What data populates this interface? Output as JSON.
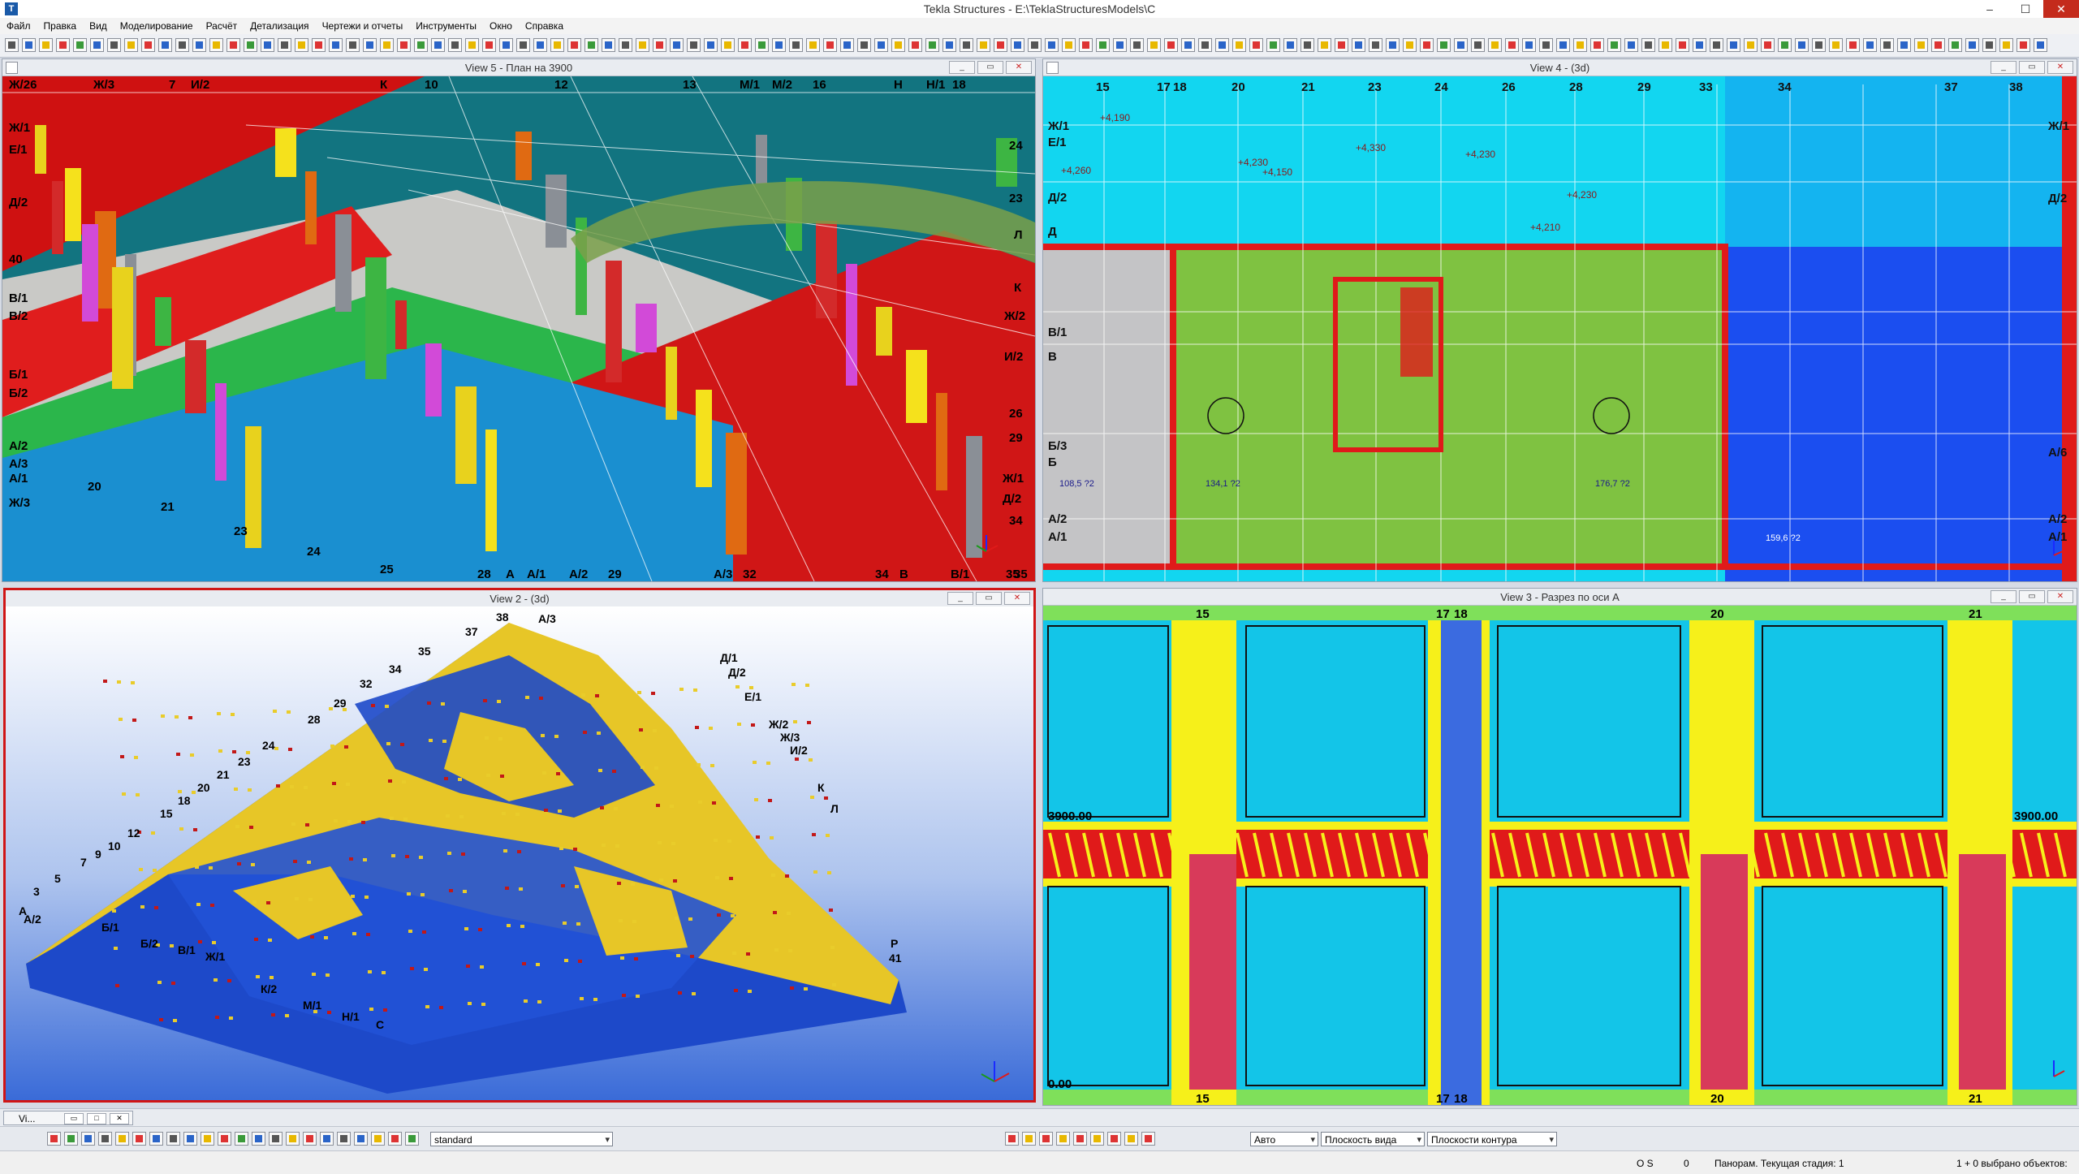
{
  "app": {
    "title": "Tekla Structures - E:\\TeklaStructuresModels\\C"
  },
  "menu": [
    "Файл",
    "Правка",
    "Вид",
    "Моделирование",
    "Расчёт",
    "Детализация",
    "Чертежи и отчеты",
    "Инструменты",
    "Окно",
    "Справка"
  ],
  "views": {
    "view5": {
      "title": "View 5 - План на 3900",
      "grid_labels_top": [
        "Ж/26",
        "Ж/3",
        "7",
        "И/2",
        "К",
        "10",
        "12",
        "13",
        "М/1",
        "М/2",
        "16",
        "Н",
        "Н/1",
        "18"
      ],
      "grid_labels_left": [
        "Ж/1",
        "Е/1",
        "Д/2",
        "40",
        "В/1",
        "В/2",
        "Б/1",
        "Б/2",
        "А/2",
        "А/3",
        "А/1",
        "Ж/3"
      ],
      "grid_labels_right": [
        "24",
        "23",
        "Л",
        "К",
        "Ж/2",
        "И/2",
        "29",
        "26",
        "Ж/1",
        "Д/2",
        "34",
        "35"
      ],
      "grid_labels_bottom": [
        "20",
        "21",
        "23",
        "24",
        "25",
        "28",
        "А",
        "А/1",
        "А/2",
        "29",
        "А/3",
        "32",
        "34",
        "В",
        "В/1",
        "35"
      ]
    },
    "view4": {
      "title": "View 4 - (3d)",
      "grid_labels_top": [
        "15",
        "17",
        "18",
        "20",
        "21",
        "23",
        "24",
        "26",
        "28",
        "29",
        "33",
        "34",
        "37",
        "38"
      ],
      "grid_labels_left": [
        "Ж/1",
        "Е/1",
        "Д/2",
        "Д",
        "В/1",
        "В",
        "Б/3",
        "Б",
        "А/2",
        "А/1"
      ],
      "grid_labels_right": [
        "Ж/1",
        "Д/2",
        "А/6",
        "А/2",
        "А/1"
      ],
      "annotations": [
        "+4,190",
        "+4,260",
        "+4,330",
        "+4,230",
        "+4,150",
        "+4,230",
        "+4,230",
        "+4,210",
        "108,5 ?2",
        "134,1 ?2",
        "176,7 ?2",
        "159,6 ?2"
      ]
    },
    "view2": {
      "title": "View 2 - (3d)",
      "grid_labels": [
        "38",
        "37",
        "35",
        "34",
        "32",
        "29",
        "28",
        "24",
        "23",
        "21",
        "20",
        "18",
        "15",
        "12",
        "10",
        "9",
        "7",
        "5",
        "3",
        "А",
        "А/2",
        "Б/1",
        "Б/2",
        "В/1",
        "Ж/1",
        "К/2",
        "М/1",
        "Н/1",
        "С",
        "Р",
        "41",
        "А/3",
        "Д/1",
        "Д/2",
        "Е/1",
        "Ж/2",
        "Ж/3",
        "И/2",
        "К",
        "Л"
      ]
    },
    "view3": {
      "title": "View 3 - Разрез по оси А",
      "axis_labels": [
        "15",
        "17",
        "18",
        "20",
        "21"
      ],
      "level_top": "3900.00",
      "level_bottom": "0.00"
    }
  },
  "view_tab": {
    "label": "Vi..."
  },
  "selection_bar": {
    "filter_value": "standard",
    "snap_mode": "Авто",
    "plane": "Плоскость вида",
    "contour": "Плоскости контура"
  },
  "status": {
    "os": "O S",
    "count": "0",
    "stage": "Панорам. Текущая стадия: 1",
    "selected": "1 + 0 выбрано объектов:"
  },
  "colors": {
    "accent_red": "#d01515",
    "plan_green": "#7fc241",
    "plan_blue": "#1b4ef0",
    "plan_cyan": "#12d6f0",
    "section_cyan": "#13c5e8",
    "section_yellow": "#f6f01a"
  }
}
